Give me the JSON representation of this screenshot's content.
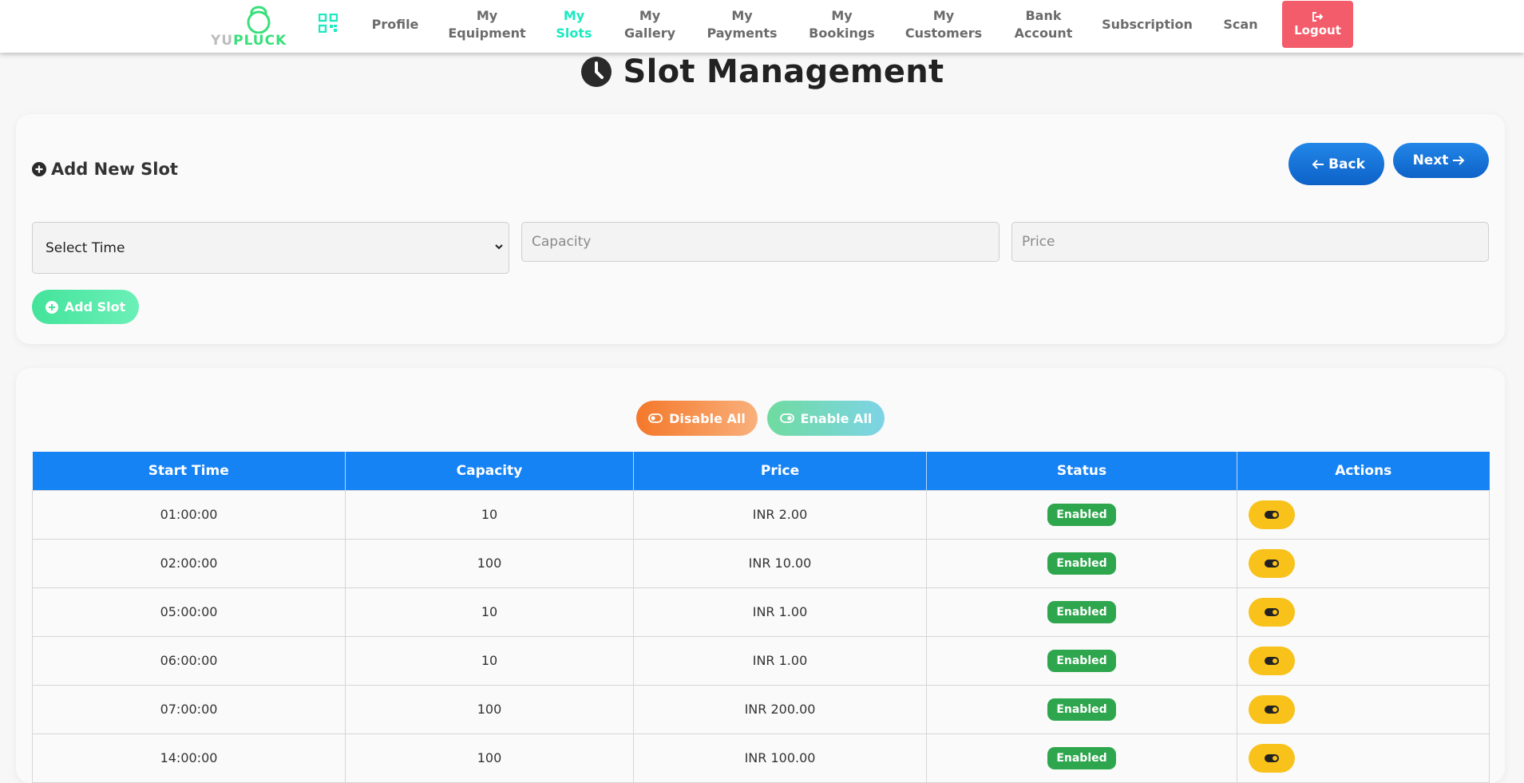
{
  "brand": {
    "logo_yu": "YU",
    "logo_pluck": "PLUCK",
    "accent": "#1de9c0"
  },
  "nav": {
    "items": [
      {
        "label": "Profile",
        "active": false
      },
      {
        "label": "My\nEquipment",
        "active": false
      },
      {
        "label": "My\nSlots",
        "active": true
      },
      {
        "label": "My\nGallery",
        "active": false
      },
      {
        "label": "My\nPayments",
        "active": false
      },
      {
        "label": "My\nBookings",
        "active": false
      },
      {
        "label": "My\nCustomers",
        "active": false
      },
      {
        "label": "Bank\nAccount",
        "active": false
      },
      {
        "label": "Subscription",
        "active": false
      },
      {
        "label": "Scan",
        "active": false
      }
    ],
    "logout_label": "Logout"
  },
  "page": {
    "title": "Slot Management"
  },
  "form": {
    "heading": "Add New Slot",
    "back_label": "Back",
    "next_label": "Next",
    "select_time_value": "Select Time",
    "capacity_placeholder": "Capacity",
    "price_placeholder": "Price",
    "add_slot_label": "Add Slot"
  },
  "bulk": {
    "disable_all_label": "Disable All",
    "enable_all_label": "Enable All"
  },
  "table": {
    "columns": [
      "Start Time",
      "Capacity",
      "Price",
      "Status",
      "Actions"
    ],
    "rows": [
      {
        "start_time": "01:00:00",
        "capacity": "10",
        "price": "INR 2.00",
        "status": "Enabled"
      },
      {
        "start_time": "02:00:00",
        "capacity": "100",
        "price": "INR 10.00",
        "status": "Enabled"
      },
      {
        "start_time": "05:00:00",
        "capacity": "10",
        "price": "INR 1.00",
        "status": "Enabled"
      },
      {
        "start_time": "06:00:00",
        "capacity": "10",
        "price": "INR 1.00",
        "status": "Enabled"
      },
      {
        "start_time": "07:00:00",
        "capacity": "100",
        "price": "INR 200.00",
        "status": "Enabled"
      },
      {
        "start_time": "14:00:00",
        "capacity": "100",
        "price": "INR 100.00",
        "status": "Enabled"
      }
    ]
  }
}
